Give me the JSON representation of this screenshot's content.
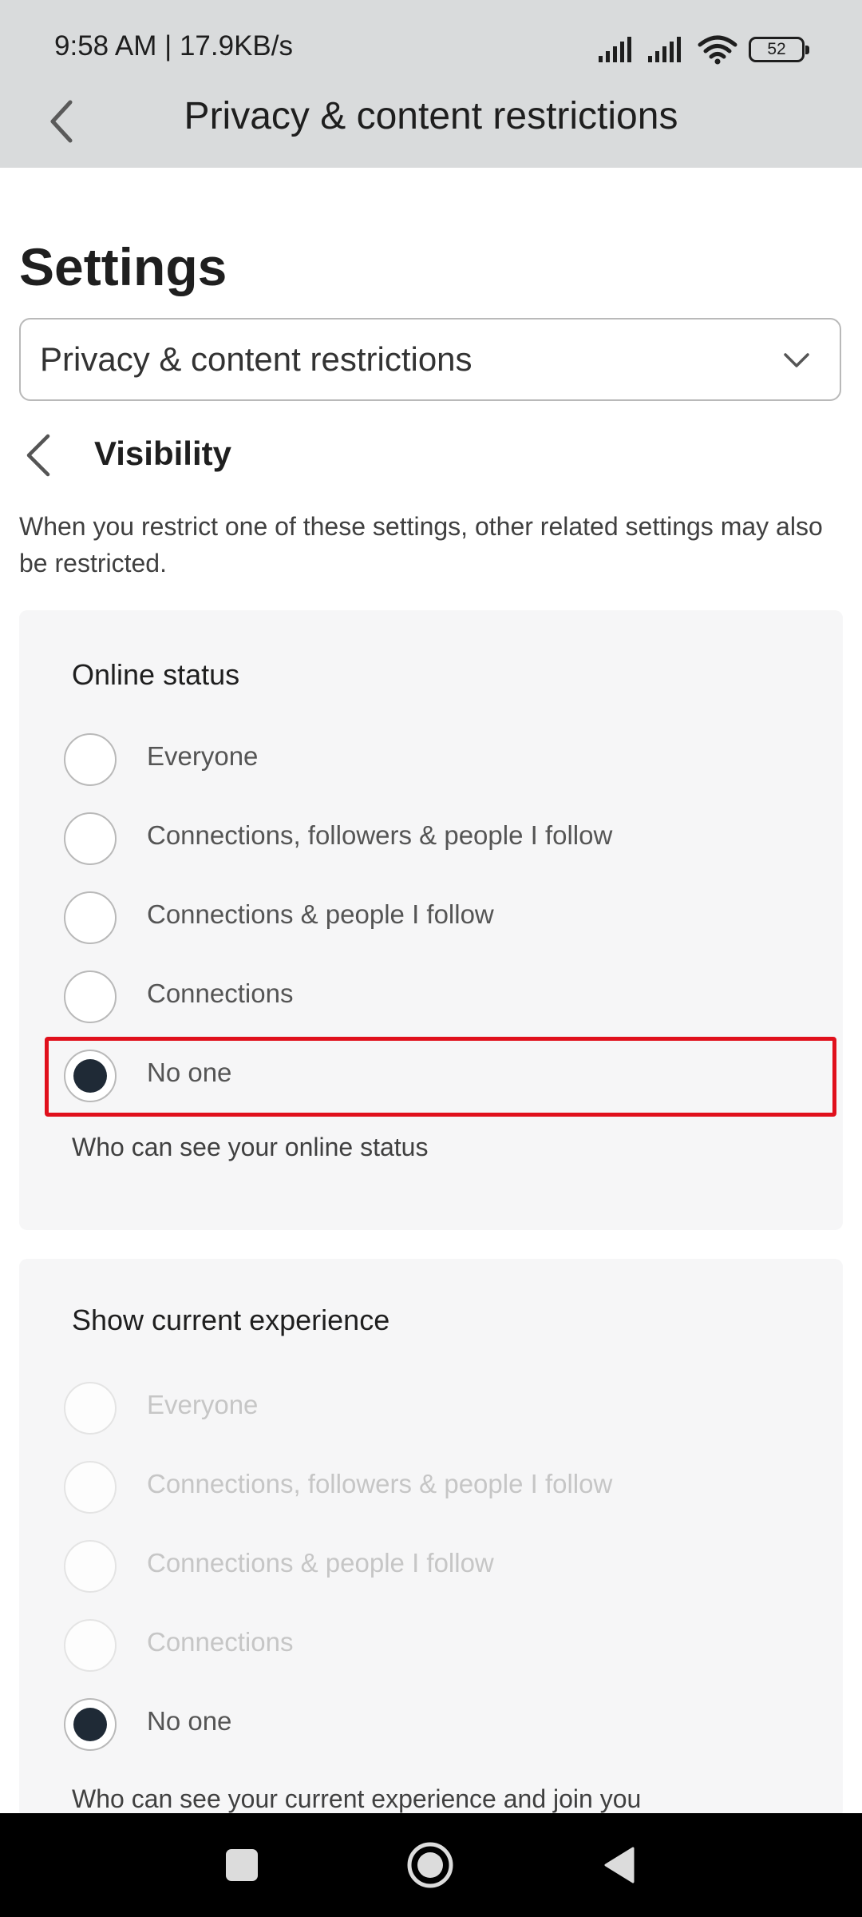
{
  "status_bar": {
    "time": "9:58 AM | 17.9KB/s",
    "battery": "52",
    "icons": [
      "signal-icon",
      "signal-icon",
      "wifi-icon",
      "battery-icon"
    ]
  },
  "app_bar": {
    "title": "Privacy & content restrictions",
    "back_icon": "back-arrow-icon"
  },
  "page": {
    "title": "Settings",
    "dropdown_value": "Privacy & content restrictions",
    "dropdown_icon": "chevron-down-icon",
    "section_title": "Visibility",
    "section_back_icon": "chevron-left-icon",
    "description": "When you restrict one of these settings, other related settings may also be restricted."
  },
  "online_status": {
    "title": "Online status",
    "options": [
      {
        "label": "Everyone",
        "selected": false
      },
      {
        "label": "Connections, followers & people I follow",
        "selected": false
      },
      {
        "label": "Connections & people I follow",
        "selected": false
      },
      {
        "label": "Connections",
        "selected": false
      },
      {
        "label": "No one",
        "selected": true
      }
    ],
    "helper": "Who can see your online status",
    "highlight_color": "#e0101c"
  },
  "current_experience": {
    "title": "Show current experience",
    "options": [
      {
        "label": "Everyone",
        "selected": false,
        "disabled": true
      },
      {
        "label": "Connections, followers & people I follow",
        "selected": false,
        "disabled": true
      },
      {
        "label": "Connections & people I follow",
        "selected": false,
        "disabled": true
      },
      {
        "label": "Connections",
        "selected": false,
        "disabled": true
      },
      {
        "label": "No one",
        "selected": true,
        "disabled": false
      }
    ],
    "helper": "Who can see your current experience and join you"
  },
  "nav_bar": {
    "buttons": [
      "recent-apps-icon",
      "home-icon",
      "back-icon"
    ]
  }
}
